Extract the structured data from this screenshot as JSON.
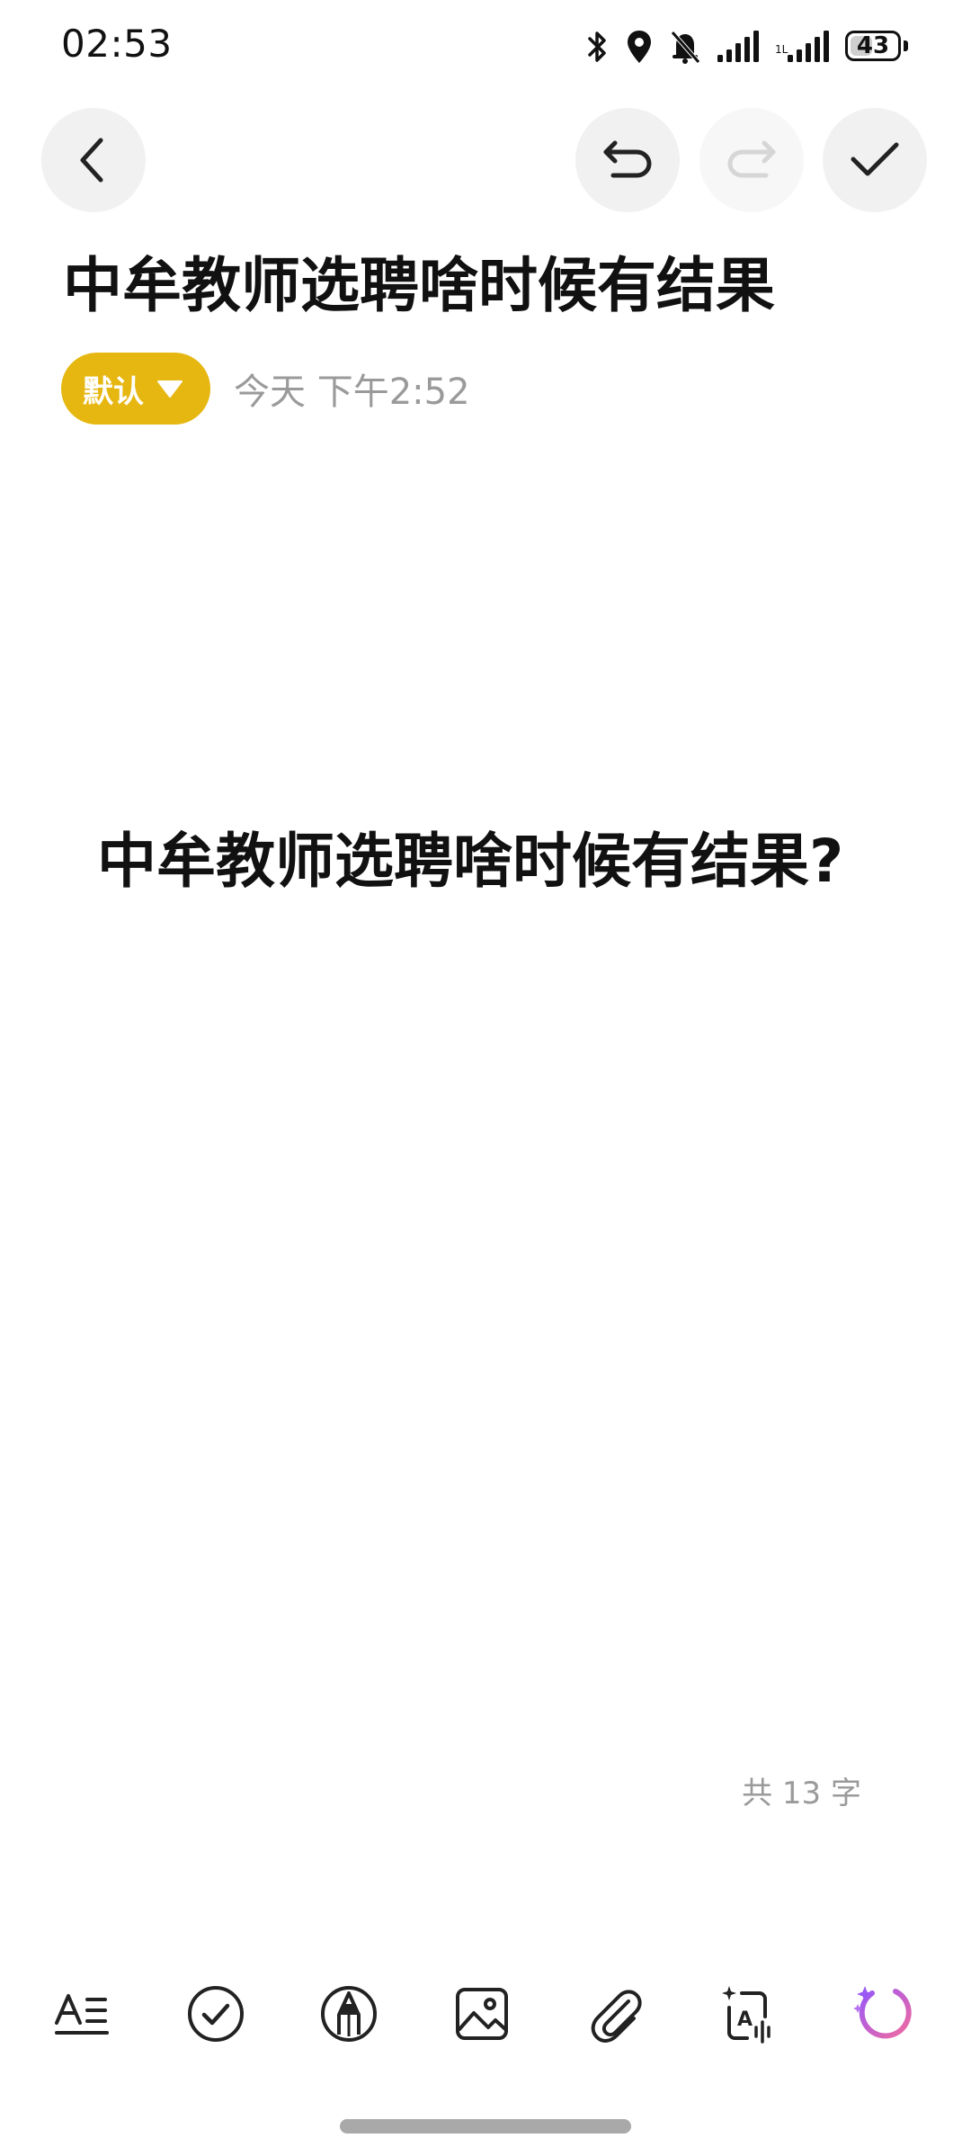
{
  "status_bar": {
    "time": "02:53",
    "battery_level": "43",
    "icons": [
      "bluetooth-icon",
      "location-icon",
      "bell-off-icon",
      "signal-icon",
      "signal-icon-2"
    ]
  },
  "header": {
    "back_icon": "chevron-left-icon",
    "undo_icon": "undo-icon",
    "redo_icon": "redo-icon",
    "done_icon": "check-icon"
  },
  "note": {
    "title": "中牟教师选聘啥时候有结果",
    "category": "默认",
    "timestamp": "今天 下午2:52",
    "body": "中牟教师选聘啥时候有结果?",
    "word_count": "共 13 字"
  },
  "toolbar": {
    "items": [
      {
        "icon": "text-format-icon"
      },
      {
        "icon": "checklist-icon"
      },
      {
        "icon": "pen-icon"
      },
      {
        "icon": "image-icon"
      },
      {
        "icon": "attachment-icon"
      },
      {
        "icon": "ai-text-icon"
      },
      {
        "icon": "ai-assistant-icon"
      }
    ]
  },
  "colors": {
    "accent": "#e6b710",
    "ai_gradient_start": "#9b59f5",
    "ai_gradient_end": "#f06aa0",
    "muted_text": "#9a9a9a"
  }
}
